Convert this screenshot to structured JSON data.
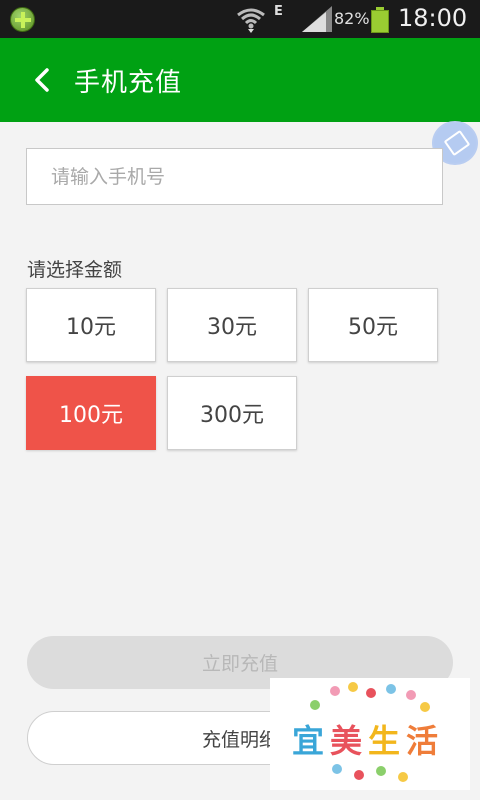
{
  "status_bar": {
    "network_type": "E",
    "battery_percent": "82%",
    "time": "18:00",
    "icons": [
      "app-icon",
      "wifi-icon",
      "signal-icon",
      "battery-icon"
    ]
  },
  "header": {
    "title": "手机充值",
    "back_icon": "chevron-left-icon",
    "background": "#00a113"
  },
  "form": {
    "phone_placeholder": "请输入手机号",
    "phone_value": "",
    "amount_label": "请选择金额",
    "amounts": [
      {
        "label": "10元",
        "selected": false
      },
      {
        "label": "30元",
        "selected": false
      },
      {
        "label": "50元",
        "selected": false
      },
      {
        "label": "100元",
        "selected": true
      },
      {
        "label": "300元",
        "selected": false
      }
    ],
    "selected_color": "#ef5349"
  },
  "actions": {
    "recharge_label": "立即充值",
    "recharge_enabled": false,
    "detail_label": "充值明细"
  },
  "watermark": {
    "text": "宜美生活"
  }
}
